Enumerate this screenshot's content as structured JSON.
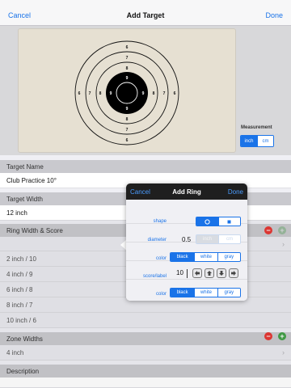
{
  "nav": {
    "cancel": "Cancel",
    "title": "Add Target",
    "done": "Done"
  },
  "target": {
    "rings": [
      {
        "label": "6"
      },
      {
        "label": "7"
      },
      {
        "label": "8"
      },
      {
        "label": "9"
      },
      {
        "label": "10"
      }
    ],
    "ring_labels": [
      "6",
      "7",
      "8",
      "9",
      "9",
      "8",
      "7",
      "6"
    ]
  },
  "measurement": {
    "label": "Measurement",
    "options": [
      "inch",
      "cm"
    ],
    "selected": "inch"
  },
  "sections": {
    "target_name": {
      "header": "Target Name",
      "value": "Club Practice 10°"
    },
    "target_width": {
      "header": "Target Width",
      "value": "12 inch"
    },
    "ring_width": {
      "header": "Ring Width & Score",
      "rows": [
        "2 inch / 10",
        "4 inch / 9",
        "6 inch / 8",
        "8 inch / 7",
        "10 inch / 6"
      ]
    },
    "zone_widths": {
      "header": "Zone Widths",
      "value": "4 inch"
    },
    "description": {
      "header": "Description"
    }
  },
  "popover": {
    "cancel": "Cancel",
    "title": "Add Ring",
    "done": "Done",
    "shape_label": "shape",
    "shape_options": [
      "circle-icon",
      "square-icon"
    ],
    "diameter_label": "diameter",
    "diameter_value": "0.5",
    "diameter_units": [
      "inch",
      "cm"
    ],
    "color_label": "color",
    "color_options": [
      "black",
      "white",
      "gray"
    ],
    "color_selected": "black",
    "score_label": "score/label",
    "score_value": "10",
    "color2_label": "color",
    "color2_options": [
      "black",
      "white",
      "gray"
    ],
    "color2_selected": "black"
  },
  "colors": {
    "accent": "#1a73e8",
    "target_bg": "#e6e0d2",
    "bull": "#000000"
  }
}
